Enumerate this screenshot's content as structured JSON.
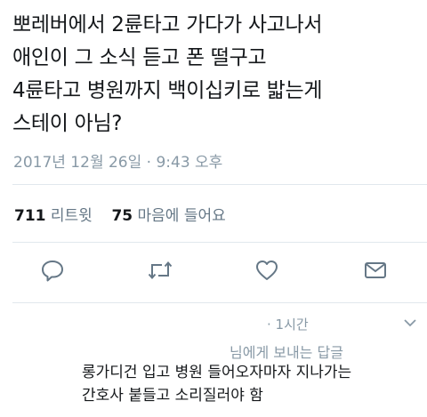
{
  "tweet": {
    "lines": [
      "뽀레버에서 2륜타고 가다가 사고나서",
      "애인이 그 소식 듣고 폰 떨구고",
      "4륜타고 병원까지 백이십키로 밟는게",
      "스테이 아님?"
    ],
    "timestamp": "2017년 12월 26일 · 9:43 오후"
  },
  "stats": {
    "retweets_count": "711",
    "retweets_label": "리트윗",
    "likes_count": "75",
    "likes_label": "마음에 들어요"
  },
  "actions": {
    "reply_icon": "reply-bubble-icon",
    "retweet_icon": "retweet-icon",
    "like_icon": "heart-icon",
    "share_icon": "envelope-icon"
  },
  "reply": {
    "time": "· 1시간",
    "reply_to": "님에게 보내는 답글",
    "lines": [
      "롱가디건 입고 병원 들어오자마자 지나가는",
      "간호사 붙들고 소리질러야 함"
    ]
  },
  "colors": {
    "text": "#14171a",
    "muted": "#8899a6",
    "icon": "#657786",
    "divider": "#e1e8ed"
  }
}
